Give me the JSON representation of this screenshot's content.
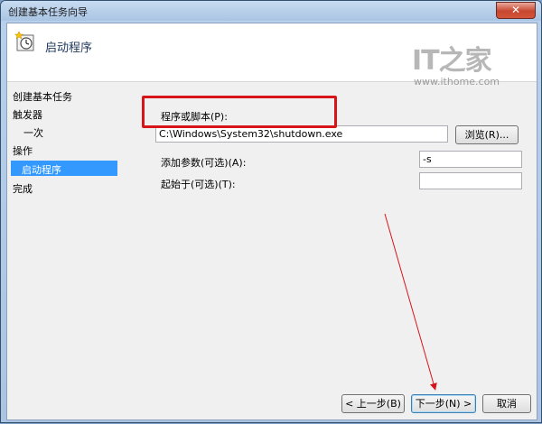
{
  "window": {
    "title": "创建基本任务向导",
    "close_glyph": "✕"
  },
  "header": {
    "title": "启动程序",
    "icon": "task-clock-icon"
  },
  "watermark": {
    "logo": "IT之家",
    "url": "www.ithome.com"
  },
  "sidebar": {
    "items": [
      {
        "label": "创建基本任务"
      },
      {
        "label": "触发器"
      },
      {
        "label": "一次"
      },
      {
        "label": "操作"
      },
      {
        "label": "启动程序"
      },
      {
        "label": "完成"
      }
    ]
  },
  "form": {
    "program_label": "程序或脚本(P):",
    "program_value": "C:\\Windows\\System32\\shutdown.exe",
    "browse_label": "浏览(R)...",
    "args_label": "添加参数(可选)(A):",
    "args_value": "-s",
    "startin_label": "起始于(可选)(T):",
    "startin_value": ""
  },
  "footer": {
    "back_label": "< 上一步(B)",
    "next_label": "下一步(N) >",
    "cancel_label": "取消"
  },
  "colors": {
    "highlight": "#d7141a",
    "selection": "#3399ff"
  }
}
